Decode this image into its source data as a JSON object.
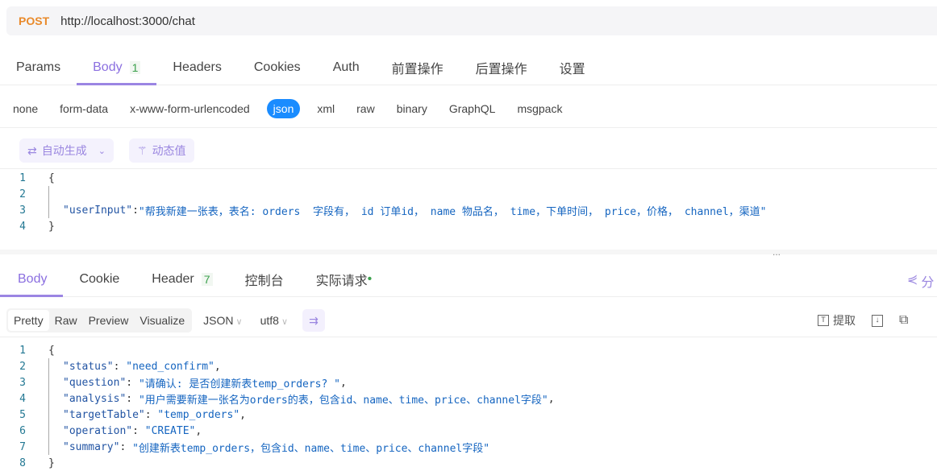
{
  "request": {
    "method": "POST",
    "url": "http://localhost:3000/chat"
  },
  "request_tabs": [
    {
      "label": "Params"
    },
    {
      "label": "Body",
      "badge": "1"
    },
    {
      "label": "Headers"
    },
    {
      "label": "Cookies"
    },
    {
      "label": "Auth"
    },
    {
      "label": "前置操作"
    },
    {
      "label": "后置操作"
    },
    {
      "label": "设置"
    }
  ],
  "body_types": [
    "none",
    "form-data",
    "x-www-form-urlencoded",
    "json",
    "xml",
    "raw",
    "binary",
    "GraphQL",
    "msgpack"
  ],
  "body_toolbar": {
    "auto_generate": "自动生成",
    "dynamic_value": "动态值"
  },
  "request_code": [
    {
      "n": "1",
      "brace": "{"
    },
    {
      "n": "2"
    },
    {
      "n": "3",
      "key": "\"userInput\"",
      "sep": ":",
      "value": "\"帮我新建一张表，表名: orders  字段有， id 订单id， name 物品名， time，下单时间， price，价格， channel，渠道\""
    },
    {
      "n": "4",
      "brace": "}"
    }
  ],
  "splitter": "...",
  "response_tabs": [
    {
      "label": "Body"
    },
    {
      "label": "Cookie"
    },
    {
      "label": "Header",
      "badge": "7"
    },
    {
      "label": "控制台"
    },
    {
      "label": "实际请求",
      "dot": "•"
    }
  ],
  "share_label": "分",
  "response_toolbar": {
    "views": [
      "Pretty",
      "Raw",
      "Preview",
      "Visualize"
    ],
    "format": "JSON",
    "encoding": "utf8",
    "extract": "提取"
  },
  "response_code": [
    {
      "n": "1",
      "brace": "{"
    },
    {
      "n": "2",
      "key": "\"status\"",
      "sep": ": ",
      "value": "\"need_confirm\"",
      "end": ","
    },
    {
      "n": "3",
      "key": "\"question\"",
      "sep": ": ",
      "value": "\"请确认: 是否创建新表temp_orders? \"",
      "end": ","
    },
    {
      "n": "4",
      "key": "\"analysis\"",
      "sep": ": ",
      "value": "\"用户需要新建一张名为orders的表，包含id、name、time、price、channel字段\"",
      "end": ","
    },
    {
      "n": "5",
      "key": "\"targetTable\"",
      "sep": ": ",
      "value": "\"temp_orders\"",
      "end": ","
    },
    {
      "n": "6",
      "key": "\"operation\"",
      "sep": ": ",
      "value": "\"CREATE\"",
      "end": ","
    },
    {
      "n": "7",
      "key": "\"summary\"",
      "sep": ": ",
      "value": "\"创建新表temp_orders，包含id、name、time、price、channel字段\""
    },
    {
      "n": "8",
      "brace": "}"
    }
  ]
}
